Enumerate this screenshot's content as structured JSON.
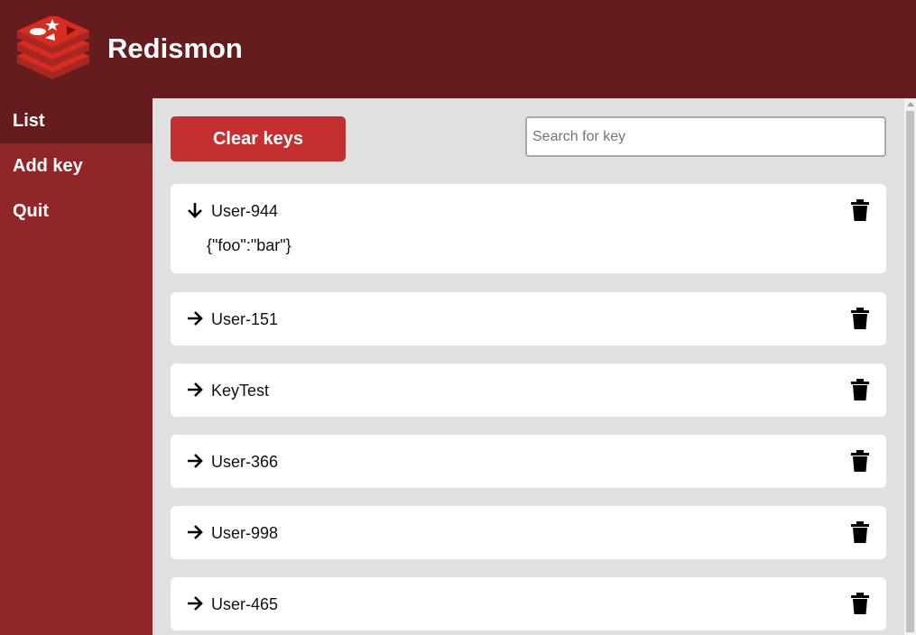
{
  "app": {
    "title": "Redismon"
  },
  "colors": {
    "header": "#641c1f",
    "sidebar": "#912629",
    "accent": "#c4302f",
    "content_bg": "#e0e0e0"
  },
  "sidebar": {
    "items": [
      {
        "label": "List",
        "active": true
      },
      {
        "label": "Add key",
        "active": false
      },
      {
        "label": "Quit",
        "active": false
      }
    ]
  },
  "toolbar": {
    "clear_label": "Clear keys"
  },
  "search": {
    "placeholder": "Search for key",
    "value": ""
  },
  "keys": [
    {
      "name": "User-944",
      "expanded": true,
      "value": "{\"foo\":\"bar\"}",
      "arrow_icon": "arrow-down-icon",
      "delete_icon": "trash-icon"
    },
    {
      "name": "User-151",
      "expanded": false,
      "arrow_icon": "arrow-right-icon",
      "delete_icon": "trash-icon"
    },
    {
      "name": "KeyTest",
      "expanded": false,
      "arrow_icon": "arrow-right-icon",
      "delete_icon": "trash-icon"
    },
    {
      "name": "User-366",
      "expanded": false,
      "arrow_icon": "arrow-right-icon",
      "delete_icon": "trash-icon"
    },
    {
      "name": "User-998",
      "expanded": false,
      "arrow_icon": "arrow-right-icon",
      "delete_icon": "trash-icon"
    },
    {
      "name": "User-465",
      "expanded": false,
      "arrow_icon": "arrow-right-icon",
      "delete_icon": "trash-icon"
    }
  ]
}
